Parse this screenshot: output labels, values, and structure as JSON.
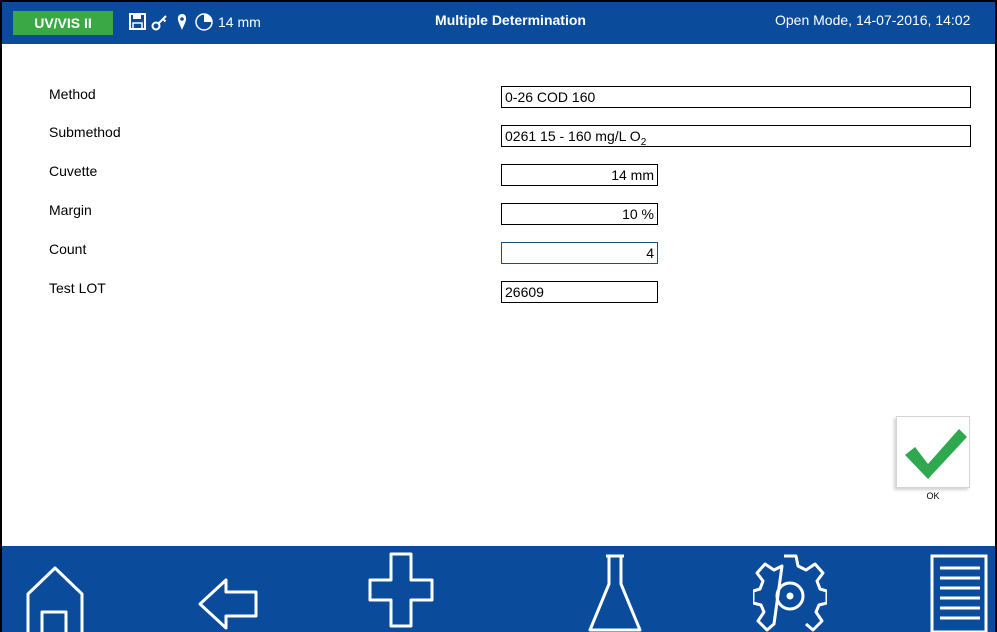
{
  "status_bar": {
    "device": "UV/VIS II",
    "icons": [
      "save-icon",
      "key-icon",
      "location-pin-icon",
      "cuvette-pie-icon"
    ],
    "cuvette_size": "14 mm",
    "title": "Multiple Determination",
    "mode_datetime": "Open Mode, 14-07-2016, 14:02"
  },
  "form": {
    "method": {
      "label": "Method",
      "value": "0-26 COD 160"
    },
    "submethod": {
      "label": "Submethod",
      "value_prefix": "0261 15 - 160 mg/L O",
      "value_sub": "2"
    },
    "cuvette": {
      "label": "Cuvette",
      "value": "14 mm"
    },
    "margin": {
      "label": "Margin",
      "value": "10 %"
    },
    "count": {
      "label": "Count",
      "value": "4"
    },
    "test_lot": {
      "label": "Test LOT",
      "value": "26609"
    }
  },
  "ok_button": {
    "label": "OK",
    "icon": "checkmark-icon",
    "color": "#2fa84f"
  },
  "nav": [
    "home-icon",
    "back-arrow-icon",
    "plus-icon",
    "flask-icon",
    "settings-gear-icon",
    "menu-list-icon"
  ],
  "colors": {
    "bar": "#0a4b9b",
    "badge": "#3aa845"
  }
}
